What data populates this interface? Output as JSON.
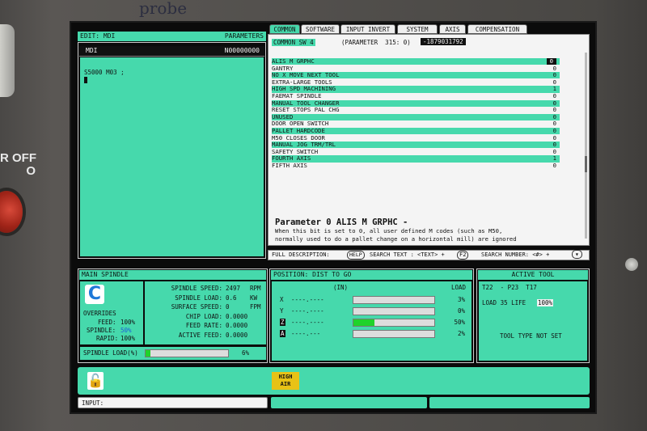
{
  "handwriting": "probe",
  "side_label": "R OFF\nO",
  "mdi_header": {
    "left": "EDIT: MDI",
    "right": "PARAMETERS"
  },
  "mdi_title": {
    "left": "MDI",
    "right": "N00000000"
  },
  "mdi_program": "S5000 M03 ;",
  "tabs": [
    "COMMON",
    "SOFTWARE",
    "INPUT INVERT",
    "SYSTEM",
    "AXIS",
    "COMPENSATION"
  ],
  "common_sw": {
    "label": "COMMON SW 4",
    "param": "(PARAMETER  315: 0)",
    "value": "-1879031792"
  },
  "params": [
    {
      "name": "ALIS M GRPHC",
      "val": "0",
      "hl": true
    },
    {
      "name": "GANTRY",
      "val": "0",
      "hl": false
    },
    {
      "name": "NO X MOVE NEXT TOOL",
      "val": "0",
      "hl": true
    },
    {
      "name": "EXTRA-LARGE TOOLS",
      "val": "0",
      "hl": false
    },
    {
      "name": "HIGH SPD MACHINING",
      "val": "1",
      "hl": true
    },
    {
      "name": "FAEMAT SPINDLE",
      "val": "0",
      "hl": false
    },
    {
      "name": "MANUAL TOOL CHANGER",
      "val": "0",
      "hl": true
    },
    {
      "name": "RESET STOPS PAL CHG",
      "val": "0",
      "hl": false
    },
    {
      "name": "UNUSED",
      "val": "0",
      "hl": true
    },
    {
      "name": "DOOR OPEN SWITCH",
      "val": "0",
      "hl": false
    },
    {
      "name": "PALLET HARDCODE",
      "val": "0",
      "hl": true
    },
    {
      "name": "M50 CLOSES DOOR",
      "val": "0",
      "hl": false
    },
    {
      "name": "MANUAL JOG TRM/TRL",
      "val": "0",
      "hl": true
    },
    {
      "name": "SAFETY SWITCH",
      "val": "0",
      "hl": false
    },
    {
      "name": "FOURTH AXIS",
      "val": "1",
      "hl": true
    },
    {
      "name": "FIFTH  AXIS",
      "val": "0",
      "hl": false
    }
  ],
  "param_desc": {
    "title": "Parameter 0 ALIS M GRPHC -",
    "line1": "When this bit is set to 0, all user defined M codes (such as M50,",
    "line2": "normally used to do a pallet change on a horizontal mill) are ignored"
  },
  "help_bar": {
    "full": "FULL DESCRIPTION:",
    "help": "HELP",
    "search_text": "SEARCH TEXT : <TEXT> +",
    "f2": "F2",
    "search_num": "SEARCH NUMBER: <#> +"
  },
  "spindle": {
    "title": "MAIN SPINDLE",
    "overrides": "OVERRIDES",
    "feed_label": "FEED:",
    "feed_val": "100%",
    "spindle_label": "SPINDLE:",
    "spindle_val": "50%",
    "rapid_label": "RAPID:",
    "rapid_val": "100%",
    "rows": [
      {
        "label": "SPINDLE SPEED:",
        "val": "2497",
        "unit": "RPM"
      },
      {
        "label": "SPINDLE LOAD:",
        "val": "0.6",
        "unit": "KW"
      },
      {
        "label": "SURFACE SPEED:",
        "val": "0",
        "unit": "FPM"
      },
      {
        "label": "CHIP LOAD:",
        "val": "0.0000",
        "unit": ""
      },
      {
        "label": "FEED RATE:",
        "val": "0.0000",
        "unit": ""
      },
      {
        "label": "ACTIVE FEED:",
        "val": "0.0000",
        "unit": ""
      }
    ],
    "load_label": "SPINDLE LOAD(%)",
    "load_pct": "6%",
    "load_frac": 0.06
  },
  "position": {
    "title": "POSITION: DIST TO GO",
    "unit": "(IN)",
    "load": "LOAD",
    "axes": [
      {
        "name": "X",
        "val": "----.----",
        "pct": "3%",
        "frac": 0.0
      },
      {
        "name": "Y",
        "val": "----.----",
        "pct": "0%",
        "frac": 0.0
      },
      {
        "name": "Z",
        "val": "----.----",
        "pct": "50%",
        "frac": 0.26
      },
      {
        "name": "A",
        "val": "----.---",
        "pct": "2%",
        "frac": 0.0
      }
    ]
  },
  "tool": {
    "title": "ACTIVE TOOL",
    "line1": "T22  - P23  T17",
    "load_life": "LOAD 35 LIFE",
    "life_pct": "100%",
    "type": "TOOL TYPE NOT SET"
  },
  "status": {
    "high_air": "HIGH\nAIR",
    "input": "INPUT:"
  }
}
